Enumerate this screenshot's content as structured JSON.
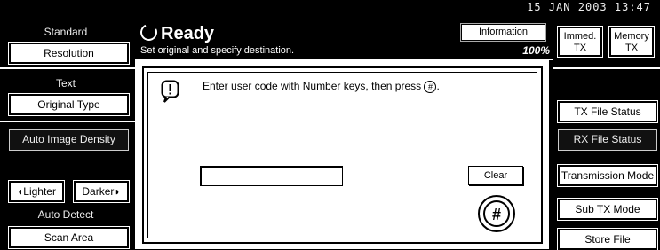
{
  "datetime": "15 JAN  2003 13:47",
  "header": {
    "status": "Ready",
    "subtitle": "Set original and specify destination.",
    "info_button": "Information",
    "percent": "100%"
  },
  "left_panel": {
    "standard_label": "Standard",
    "resolution_button": "Resolution",
    "text_label": "Text",
    "original_type_button": "Original Type",
    "auto_image_density_button": "Auto Image Density",
    "lighter_button": "Lighter",
    "darker_button": "Darker",
    "auto_detect_label": "Auto Detect",
    "scan_area_button": "Scan Area"
  },
  "dialog": {
    "message_before": "Enter user code with Number keys, then press",
    "message_symbol": "#",
    "message_after": ".",
    "input_value": "",
    "clear_button": "Clear",
    "hash_button": "#"
  },
  "right_panel": {
    "immed_tx": "Immed. TX",
    "immed_line1": "Immed.",
    "immed_line2": "TX",
    "memory_line1": "Memory",
    "memory_line2": "TX",
    "tx_file_status": "TX File Status",
    "rx_file_status": "RX File Status",
    "transmission_mode": "Transmission Mode",
    "sub_tx_mode": "Sub TX Mode",
    "store_file": "Store File"
  }
}
